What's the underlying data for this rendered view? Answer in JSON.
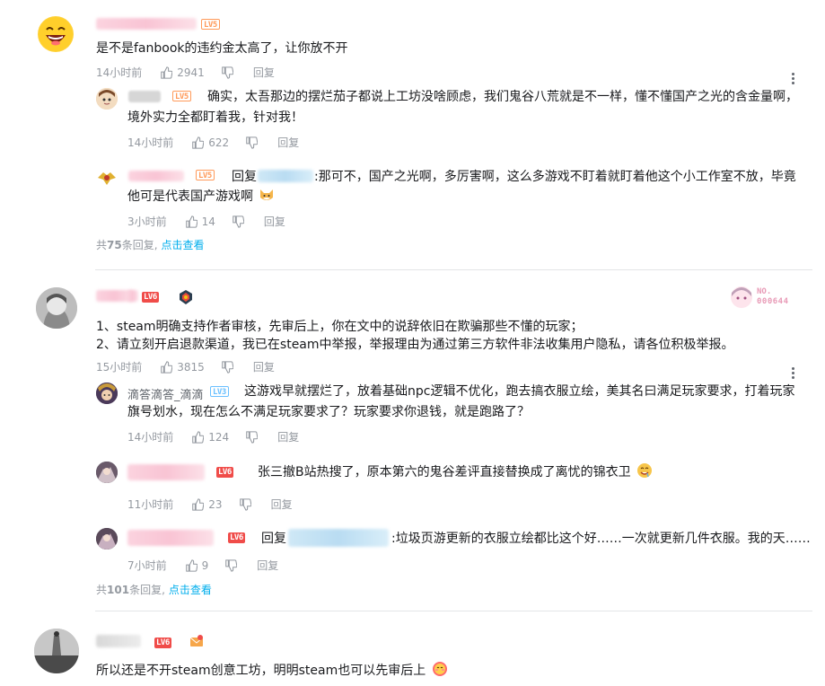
{
  "threads": [
    {
      "level": "LV5",
      "content": "是不是fanbook的违约金太高了，让你放不开",
      "time": "14小时前",
      "likes": "2941",
      "reply_label": "回复",
      "replies": [
        {
          "level": "LV5",
          "content_line1": "确实，太吾那边的摆烂茄子都说上工坊没啥顾虑，我们鬼谷八荒就是不一样，懂不懂国产之光的含金量啊，",
          "content_line2": "境外实力全都盯着我，针对我！",
          "time": "14小时前",
          "likes": "622",
          "reply_label": "回复"
        },
        {
          "level": "LV5",
          "reply_prefix": "回复",
          "content_line1": ":那可不，国产之光啊，多厉害啊，这么多游戏不盯着就盯着他这个小工作室不放，毕竟",
          "content_line2": "他可是代表国产游戏啊",
          "time": "3小时前",
          "likes": "14",
          "reply_label": "回复"
        }
      ],
      "more": {
        "prefix": "共",
        "count": "75",
        "suffix": "条回复,",
        "link": "点击查看"
      }
    },
    {
      "level": "LV6",
      "badge_text": "NO.",
      "badge_number": "000644",
      "content_line1": "1、steam明确支持作者审核，先审后上，你在文中的说辞依旧在欺骗那些不懂的玩家；",
      "content_line2": "2、请立刻开启退款渠道，我已在steam中举报，举报理由为通过第三方软件非法收集用户隐私，请各位积极举报。",
      "time": "15小时前",
      "likes": "3815",
      "reply_label": "回复",
      "replies": [
        {
          "username": "滴答滴答_滴滴",
          "level": "LV3",
          "content_line1": "这游戏早就摆烂了，放着基础npc逻辑不优化，跑去搞衣服立绘，美其名曰满足玩家要求，打着玩家",
          "content_line2": "旗号划水，现在怎么不满足玩家要求了？玩家要求你退钱，就是跑路了？",
          "time": "14小时前",
          "likes": "124",
          "reply_label": "回复"
        },
        {
          "level": "LV6",
          "content_line1": "张三撤B站热搜了，原本第六的鬼谷差评直接替换成了离忧的锦衣卫",
          "time": "11小时前",
          "likes": "23",
          "reply_label": "回复"
        },
        {
          "level": "LV6",
          "reply_prefix": "回复",
          "content_line1": ":垃圾页游更新的衣服立绘都比这个好……一次就更新几件衣服。我的天……",
          "time": "7小时前",
          "likes": "9",
          "reply_label": "回复"
        }
      ],
      "more": {
        "prefix": "共",
        "count": "101",
        "suffix": "条回复,",
        "link": "点击查看"
      }
    },
    {
      "level": "LV6",
      "content": "所以还是不开steam创意工坊，明明steam也可以先审后上"
    }
  ],
  "colors": {
    "link": "#00aeec",
    "meta": "#9499a0",
    "level5": "#ff9a5a",
    "level6": "#f04c49",
    "level3": "#6bc0ff"
  },
  "icons": [
    "like-icon",
    "dislike-icon",
    "more-options-icon",
    "laughing-emoji-icon",
    "fox-emoji-icon",
    "drool-emoji-icon",
    "blush-emoji-icon",
    "envelope-badge-icon",
    "crest-badge-icon"
  ]
}
